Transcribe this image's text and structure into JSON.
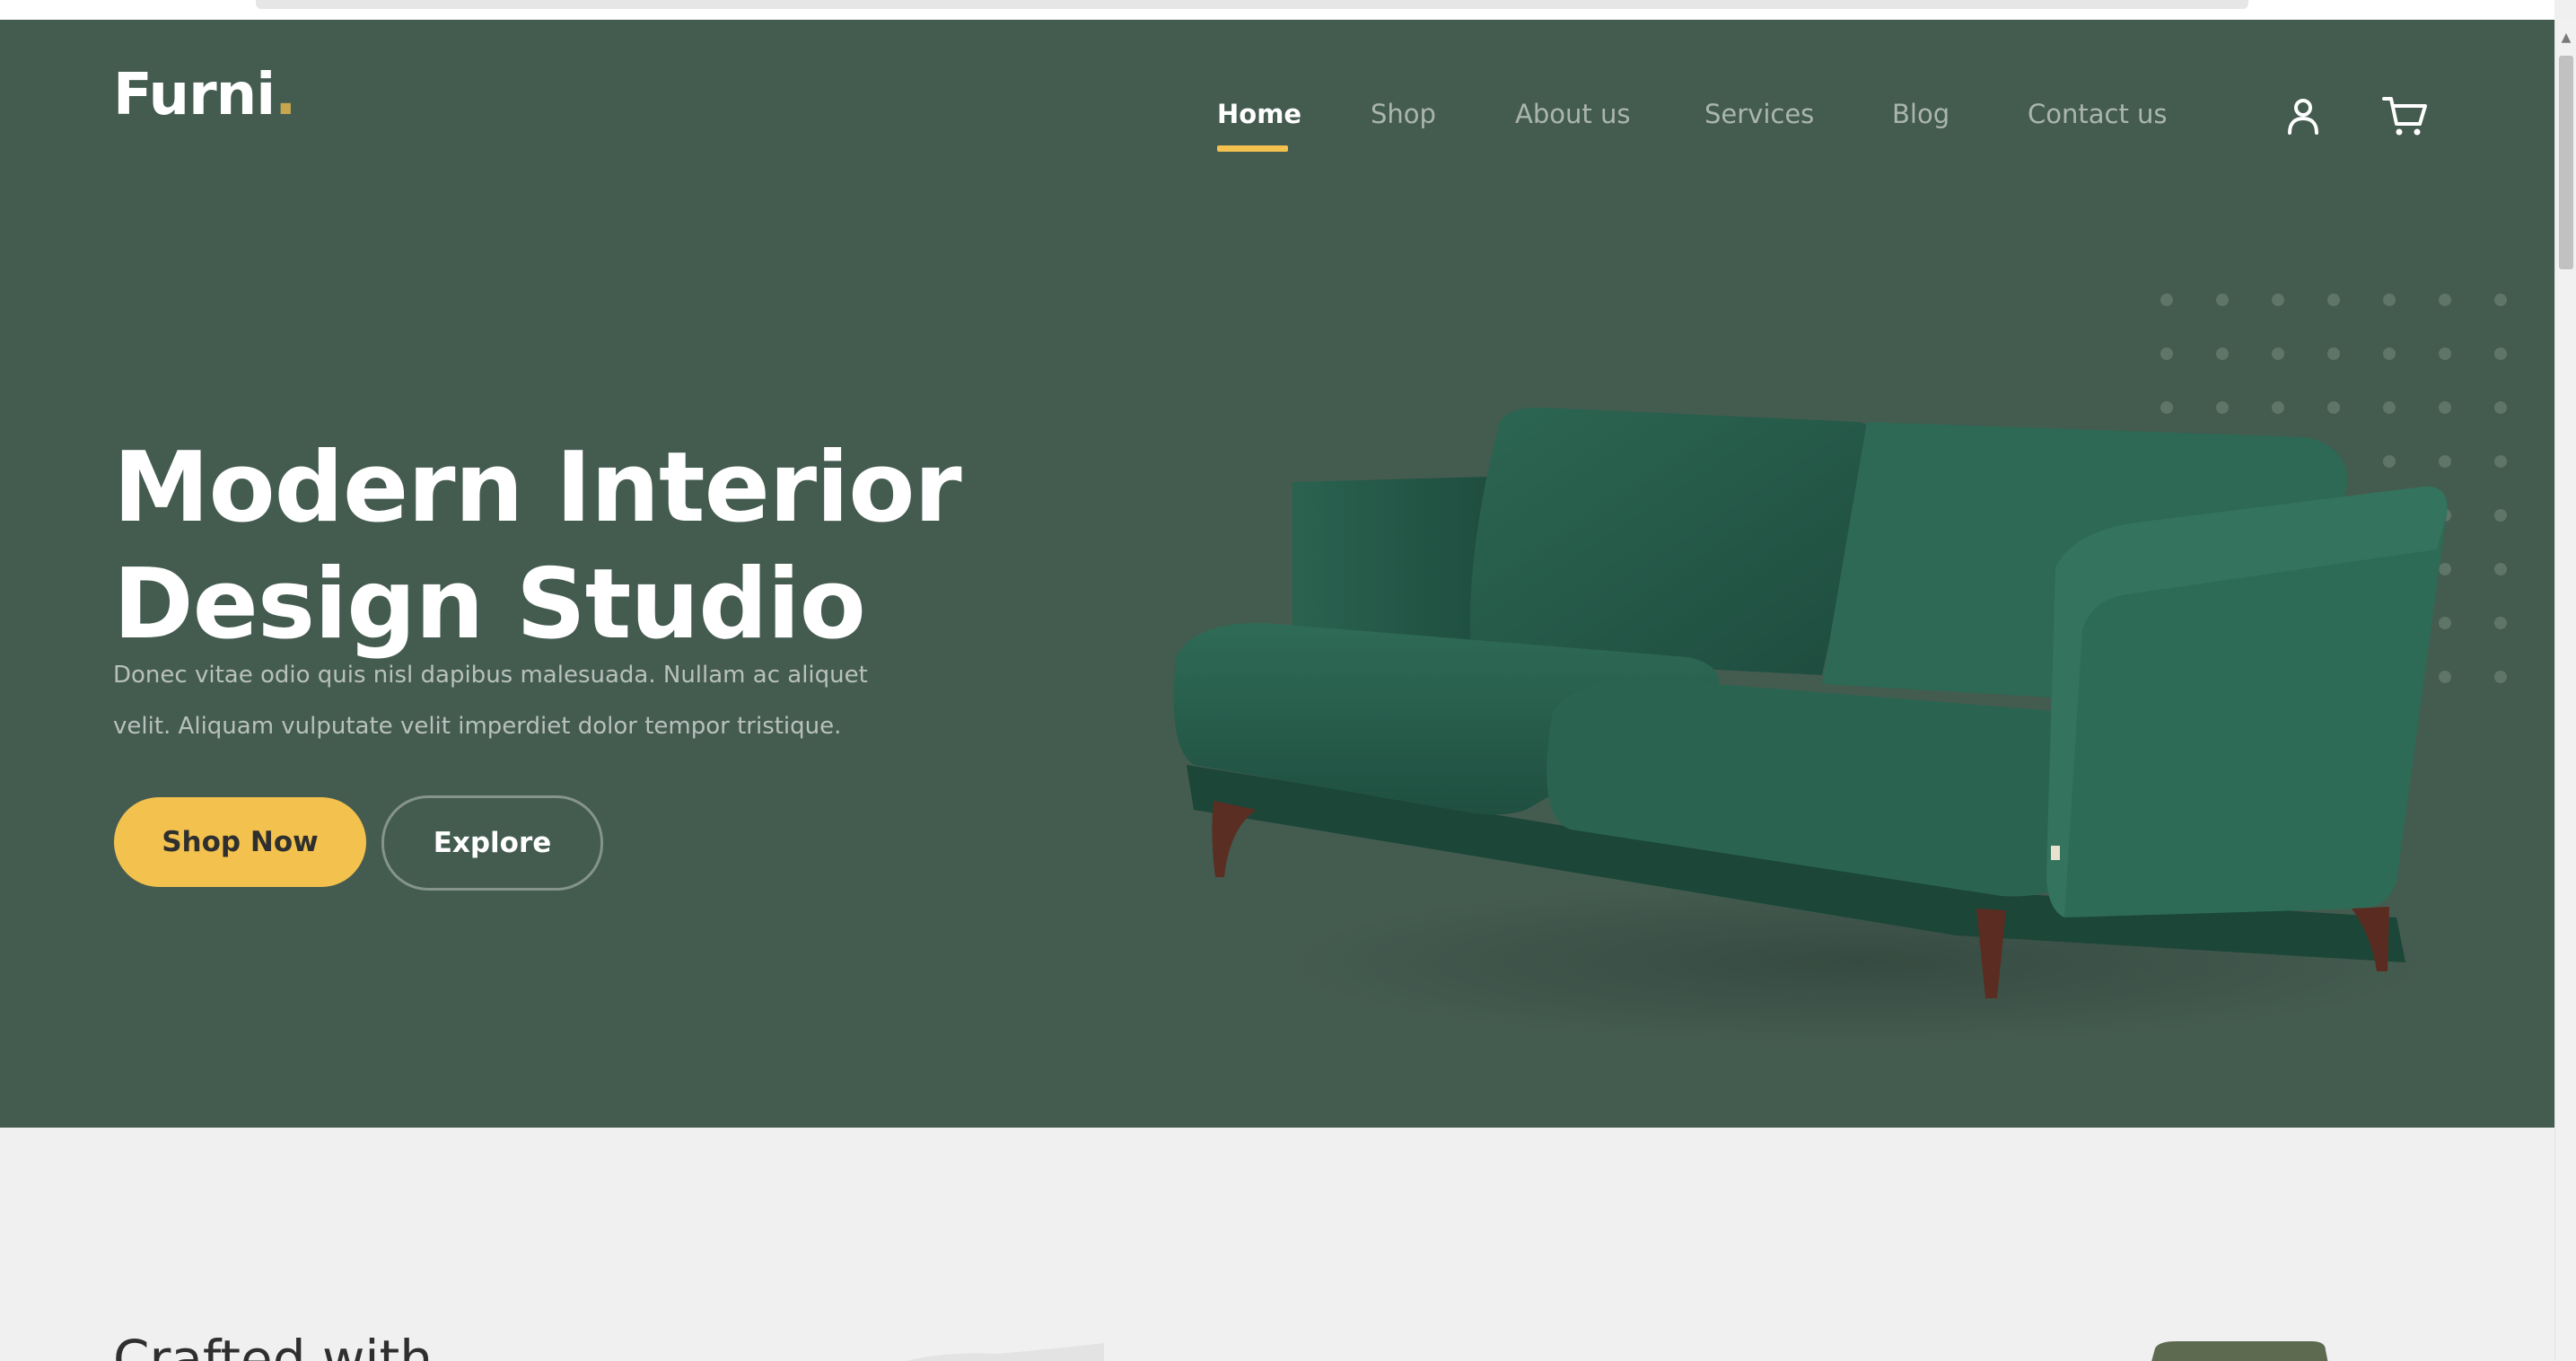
{
  "brand": {
    "name": "Furni",
    "dot": ".",
    "accent_color": "#f2c14e",
    "hero_bg_color": "#445b50"
  },
  "nav": {
    "items": [
      {
        "label": "Home",
        "active": true
      },
      {
        "label": "Shop",
        "active": false
      },
      {
        "label": "About us",
        "active": false
      },
      {
        "label": "Services",
        "active": false
      },
      {
        "label": "Blog",
        "active": false
      },
      {
        "label": "Contact us",
        "active": false
      }
    ],
    "icons": [
      "user-icon",
      "cart-icon"
    ]
  },
  "hero": {
    "title_line1": "Modern Interior",
    "title_line2": "Design Studio",
    "text_line1": "Donec vitae odio quis nisl dapibus malesuada. Nullam ac aliquet",
    "text_line2": "velit. Aliquam vulputate velit imperdiet dolor tempor tristique.",
    "primary_button": "Shop Now",
    "secondary_button": "Explore",
    "image": "green velvet sofa"
  },
  "section2": {
    "title": "Crafted with"
  }
}
